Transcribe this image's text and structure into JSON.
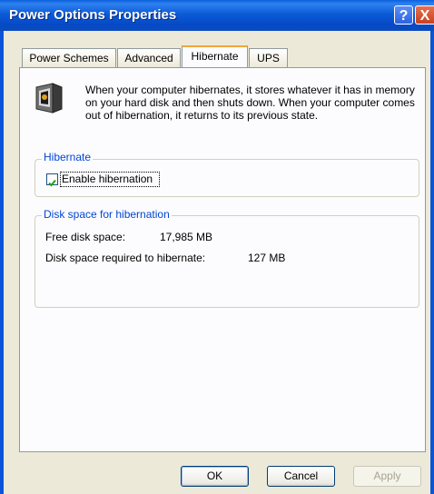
{
  "window": {
    "title": "Power Options Properties"
  },
  "titlebar": {
    "help_label": "?",
    "close_label": "X"
  },
  "tabs": [
    {
      "label": "Power Schemes"
    },
    {
      "label": "Advanced"
    },
    {
      "label": "Hibernate"
    },
    {
      "label": "UPS"
    }
  ],
  "active_tab": "Hibernate",
  "description": "When your computer hibernates, it stores whatever it has in memory on your hard disk and then shuts down. When your computer comes out of hibernation, it returns to its previous state.",
  "hibernate_group": {
    "title": "Hibernate",
    "checkbox": {
      "label": "Enable hibernation",
      "checked": true
    }
  },
  "disk_group": {
    "title": "Disk space for hibernation",
    "free_label": "Free disk space:",
    "free_value": "17,985 MB",
    "required_label": "Disk space required to hibernate:",
    "required_value": "127 MB"
  },
  "buttons": {
    "ok": "OK",
    "cancel": "Cancel",
    "apply": "Apply"
  },
  "colors": {
    "titlebar": "#0b5bd7",
    "group_title": "#0046d5",
    "check_mark": "#21a121",
    "tab_highlight": "#f1a63b"
  }
}
